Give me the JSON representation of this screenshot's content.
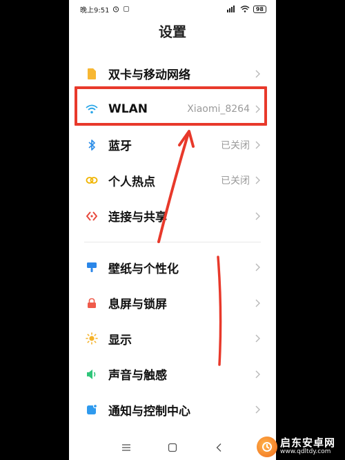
{
  "statusbar": {
    "time": "晚上9:51",
    "battery": "98"
  },
  "page": {
    "title": "设置"
  },
  "colors": {
    "sim": "#f7b733",
    "wlan": "#2aa6e8",
    "bluetooth": "#2f8fe8",
    "hotspot": "#f0b400",
    "share": "#e8483c",
    "wallpaper": "#2a86e8",
    "lock": "#ef5a4a",
    "display": "#f5b32a",
    "sound": "#2fc57a",
    "notify": "#2f9aee",
    "annotation": "#e8392b"
  },
  "settings": {
    "group1": [
      {
        "label": "双卡与移动网络",
        "icon": "sim-card-icon",
        "value": ""
      },
      {
        "label": "WLAN",
        "icon": "wifi-icon",
        "value": "Xiaomi_8264"
      },
      {
        "label": "蓝牙",
        "icon": "bluetooth-icon",
        "value": "已关闭"
      },
      {
        "label": "个人热点",
        "icon": "hotspot-icon",
        "value": "已关闭"
      },
      {
        "label": "连接与共享",
        "icon": "share-icon",
        "value": ""
      }
    ],
    "group2": [
      {
        "label": "壁纸与个性化",
        "icon": "wallpaper-icon",
        "value": ""
      },
      {
        "label": "息屏与锁屏",
        "icon": "lock-icon",
        "value": ""
      },
      {
        "label": "显示",
        "icon": "sun-icon",
        "value": ""
      },
      {
        "label": "声音与触感",
        "icon": "speaker-icon",
        "value": ""
      },
      {
        "label": "通知与控制中心",
        "icon": "notification-icon",
        "value": ""
      }
    ]
  },
  "watermark": {
    "name": "启东安卓网",
    "url": "www.qdltdy.com"
  }
}
